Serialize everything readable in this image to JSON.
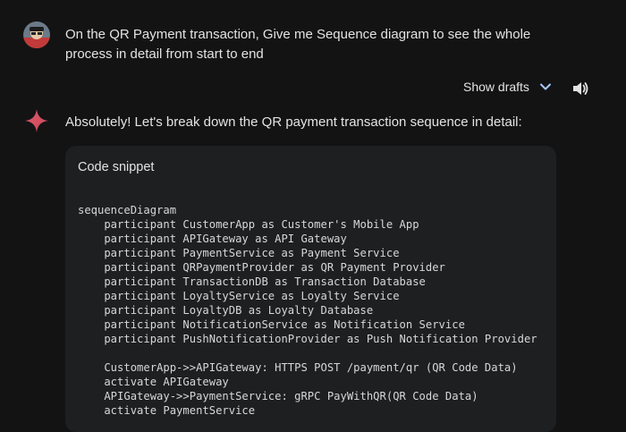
{
  "user_message": {
    "text": "On the QR Payment transaction, Give me Sequence diagram to see the whole process in detail from start to end"
  },
  "drafts": {
    "label": "Show drafts"
  },
  "response": {
    "intro": "Absolutely! Let's break down the QR payment transaction sequence in detail:",
    "code_title": "Code snippet",
    "code": "sequenceDiagram\n    participant CustomerApp as Customer's Mobile App\n    participant APIGateway as API Gateway\n    participant PaymentService as Payment Service\n    participant QRPaymentProvider as QR Payment Provider\n    participant TransactionDB as Transaction Database\n    participant LoyaltyService as Loyalty Service\n    participant LoyaltyDB as Loyalty Database\n    participant NotificationService as Notification Service\n    participant PushNotificationProvider as Push Notification Provider\n\n    CustomerApp->>APIGateway: HTTPS POST /payment/qr (QR Code Data)\n    activate APIGateway\n    APIGateway->>PaymentService: gRPC PayWithQR(QR Code Data)\n    activate PaymentService"
  },
  "icons": {
    "avatar": "user-avatar",
    "chevron": "chevron-down-icon",
    "speaker": "speaker-icon",
    "spark": "gemini-spark-icon"
  },
  "colors": {
    "background": "#131314",
    "code_background": "#1e1f20",
    "accent_blue": "#a8c7fa",
    "spark_start": "#e05a6a",
    "spark_end": "#8ab4f8"
  }
}
